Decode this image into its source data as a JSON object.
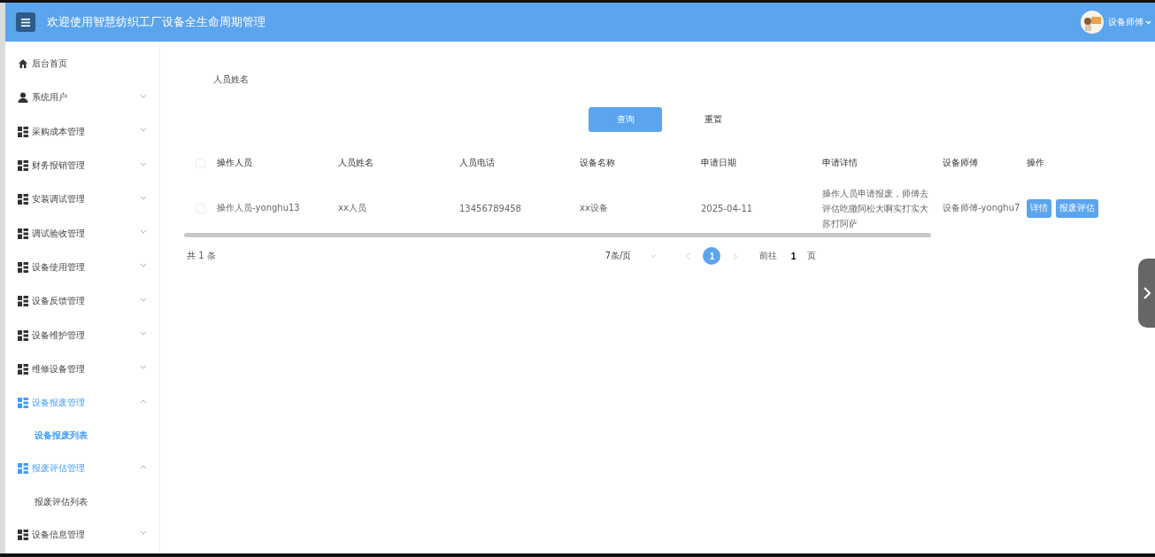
{
  "header": {
    "title": "欢迎使用智慧纺织工厂设备全生命周期管理",
    "user": "设备师傅"
  },
  "sidebar": {
    "items": [
      {
        "label": "后台首页",
        "kind": "home",
        "active": false
      },
      {
        "label": "系统用户",
        "kind": "user",
        "expanded": false,
        "active": false
      },
      {
        "label": "采购成本管理",
        "kind": "group",
        "expanded": false,
        "active": false
      },
      {
        "label": "财务报销管理",
        "kind": "group",
        "expanded": false,
        "active": false
      },
      {
        "label": "安装调试管理",
        "kind": "group",
        "expanded": false,
        "active": false
      },
      {
        "label": "调试验收管理",
        "kind": "group",
        "expanded": false,
        "active": false
      },
      {
        "label": "设备使用管理",
        "kind": "group",
        "expanded": false,
        "active": false
      },
      {
        "label": "设备反馈管理",
        "kind": "group",
        "expanded": false,
        "active": false
      },
      {
        "label": "设备维护管理",
        "kind": "group",
        "expanded": false,
        "active": false
      },
      {
        "label": "维修设备管理",
        "kind": "group",
        "expanded": false,
        "active": false
      },
      {
        "label": "设备报废管理",
        "kind": "group",
        "expanded": true,
        "active": true,
        "children": [
          {
            "label": "设备报废列表",
            "selected": true
          }
        ]
      },
      {
        "label": "报废评估管理",
        "kind": "group",
        "expanded": true,
        "active": true,
        "children": [
          {
            "label": "报废评估列表",
            "selected": false
          }
        ]
      },
      {
        "label": "设备信息管理",
        "kind": "group",
        "expanded": false,
        "active": false
      }
    ]
  },
  "search": {
    "label": "人员姓名",
    "buttons": [
      {
        "label": "查询",
        "kind": "primary"
      },
      {
        "label": "重置",
        "kind": "plain"
      }
    ]
  },
  "table": {
    "all_checked": false,
    "columns": [
      "操作人员",
      "人员姓名",
      "人员电话",
      "设备名称",
      "申请日期",
      "申请详情",
      "设备师傅",
      "操作"
    ],
    "rows": [
      {
        "checked": false,
        "cells": [
          "操作人员-yonghu13",
          "xx人员",
          "13456789458",
          "xx设备",
          "2025-04-11",
          "操作人员申请报废，师傅去评估吃撒阿松大啊实打实大苏打阿萨",
          "设备师傅-yonghu7"
        ],
        "actions": [
          "详情",
          "报废评估"
        ]
      }
    ]
  },
  "pagination": {
    "total": "共 1 条",
    "page_size": "7条/页",
    "pages": [
      {
        "label": "1",
        "selected": true
      }
    ],
    "goto_label": "前往",
    "goto_value": "1",
    "goto_suffix": "页"
  }
}
